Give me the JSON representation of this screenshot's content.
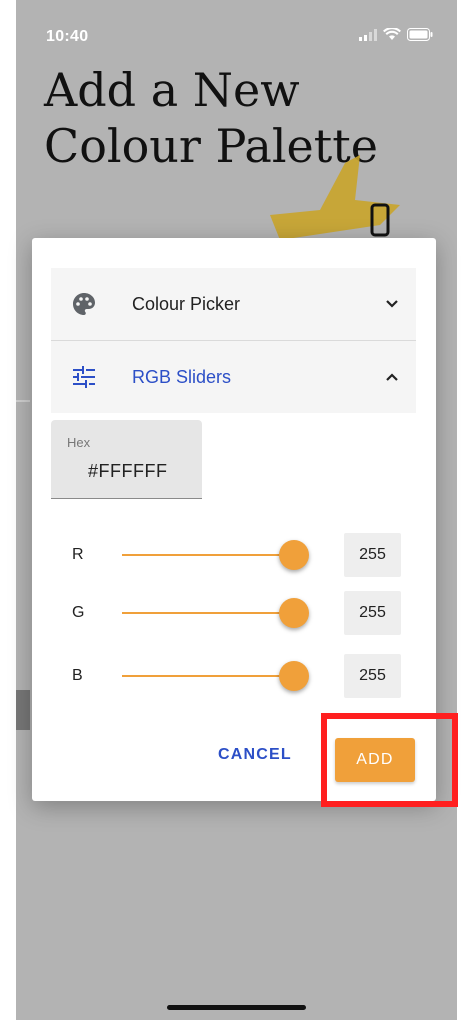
{
  "status_bar": {
    "time": "10:40"
  },
  "background": {
    "title": "Add a New Colour Palette"
  },
  "dialog": {
    "accordion": [
      {
        "label": "Colour Picker",
        "icon": "palette-icon",
        "expanded": false
      },
      {
        "label": "RGB Sliders",
        "icon": "sliders-icon",
        "expanded": true
      }
    ],
    "hex_field": {
      "label": "Hex",
      "value": "#FFFFFF"
    },
    "sliders": [
      {
        "channel": "R",
        "value": "255",
        "fraction": 1.0
      },
      {
        "channel": "G",
        "value": "255",
        "fraction": 1.0
      },
      {
        "channel": "B",
        "value": "255",
        "fraction": 1.0
      }
    ],
    "actions": {
      "cancel": "CANCEL",
      "add": "ADD"
    }
  },
  "colors": {
    "accent": "#f0a03a",
    "link_blue": "#2c4fc7",
    "highlight": "#ff1f1f"
  }
}
